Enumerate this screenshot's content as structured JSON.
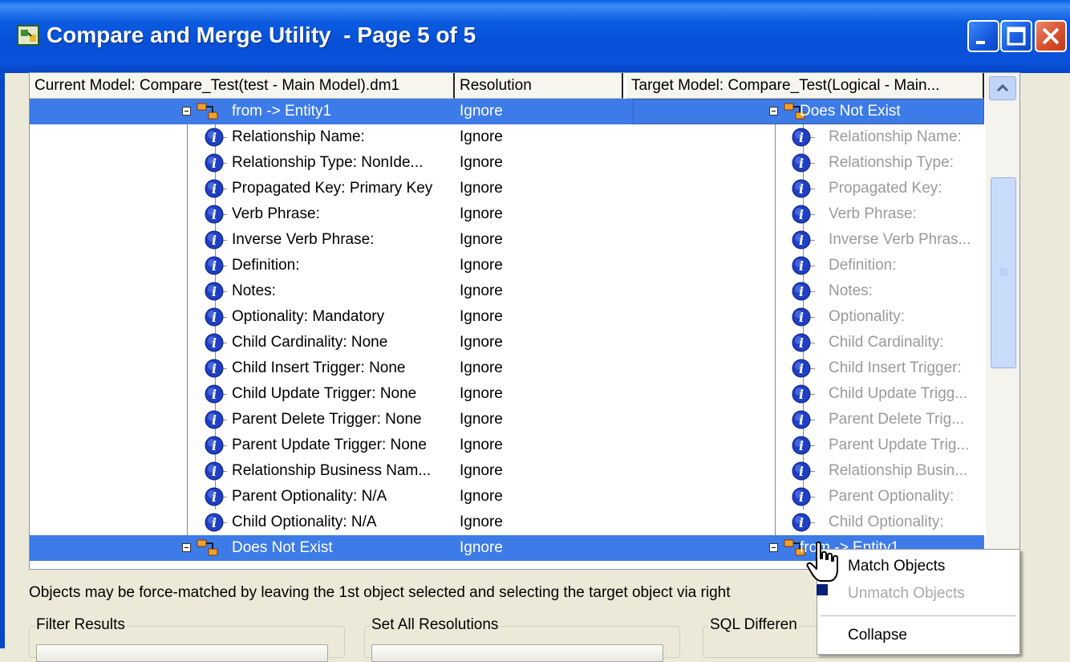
{
  "window": {
    "title": "Compare and Merge Utility  - Page 5 of 5"
  },
  "grid": {
    "headers": {
      "current": "Current Model: Compare_Test(test - Main Model).dm1",
      "resolution": "Resolution",
      "target": "Target Model: Compare_Test(Logical - Main..."
    },
    "rows": [
      {
        "current": "from -> Entity1",
        "resolution": "Ignore",
        "target": "Does Not Exist",
        "kind": "parent",
        "selected": true
      },
      {
        "current": "Relationship Name:",
        "resolution": "Ignore",
        "target": "Relationship Name:",
        "kind": "child"
      },
      {
        "current": "Relationship Type: NonIde...",
        "resolution": "Ignore",
        "target": "Relationship Type:",
        "kind": "child"
      },
      {
        "current": "Propagated Key: Primary Key",
        "resolution": "Ignore",
        "target": "Propagated Key:",
        "kind": "child"
      },
      {
        "current": "Verb Phrase:",
        "resolution": "Ignore",
        "target": "Verb Phrase:",
        "kind": "child"
      },
      {
        "current": "Inverse Verb Phrase:",
        "resolution": "Ignore",
        "target": "Inverse Verb Phras...",
        "kind": "child"
      },
      {
        "current": "Definition:",
        "resolution": "Ignore",
        "target": "Definition:",
        "kind": "child"
      },
      {
        "current": "Notes:",
        "resolution": "Ignore",
        "target": "Notes:",
        "kind": "child"
      },
      {
        "current": "Optionality: Mandatory",
        "resolution": "Ignore",
        "target": "Optionality:",
        "kind": "child"
      },
      {
        "current": "Child Cardinality: None",
        "resolution": "Ignore",
        "target": "Child Cardinality:",
        "kind": "child"
      },
      {
        "current": "Child Insert Trigger: None",
        "resolution": "Ignore",
        "target": "Child Insert Trigger:",
        "kind": "child"
      },
      {
        "current": "Child Update Trigger: None",
        "resolution": "Ignore",
        "target": "Child Update Trigg...",
        "kind": "child"
      },
      {
        "current": "Parent Delete Trigger: None",
        "resolution": "Ignore",
        "target": "Parent Delete Trig...",
        "kind": "child"
      },
      {
        "current": "Parent Update Trigger: None",
        "resolution": "Ignore",
        "target": "Parent Update Trig...",
        "kind": "child"
      },
      {
        "current": "Relationship Business Nam...",
        "resolution": "Ignore",
        "target": "Relationship Busin...",
        "kind": "child"
      },
      {
        "current": "Parent Optionality:  N/A",
        "resolution": "Ignore",
        "target": "Parent Optionality:",
        "kind": "child"
      },
      {
        "current": "Child Optionality:  N/A",
        "resolution": "Ignore",
        "target": "Child Optionality:",
        "kind": "child"
      },
      {
        "current": "Does Not Exist",
        "resolution": "Ignore",
        "target": "from -> Entity1",
        "kind": "parent",
        "selected": true
      }
    ]
  },
  "instruction": "Objects may be force-matched by leaving the 1st object selected and selecting the target object via right",
  "groups": {
    "filter": "Filter Results",
    "set_all": "Set All Resolutions",
    "sql": "SQL Differen"
  },
  "context_menu": {
    "match": "Match Objects",
    "unmatch": "Unmatch Objects",
    "collapse": "Collapse"
  },
  "colors": {
    "selection": "#3d7be8",
    "titlebar": "#0a52d9",
    "info_icon": "#1f3fc4"
  }
}
